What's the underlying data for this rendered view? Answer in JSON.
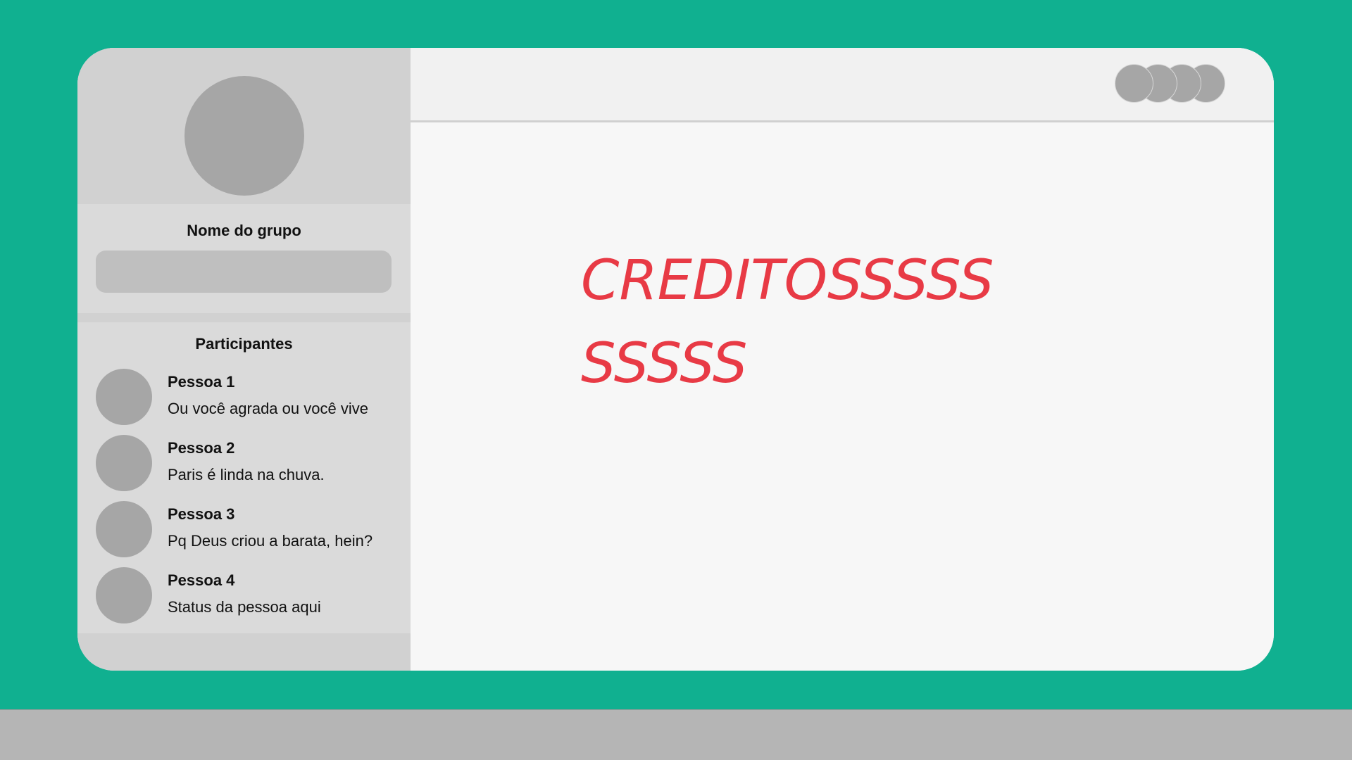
{
  "sidebar": {
    "group_name": "Nome do grupo",
    "group_input_value": "",
    "participants_title": "Participantes",
    "participants": [
      {
        "name": "Pessoa 1",
        "status": "Ou você agrada ou você vive"
      },
      {
        "name": "Pessoa 2",
        "status": "Paris é linda na chuva."
      },
      {
        "name": "Pessoa 3",
        "status": "Pq Deus criou a barata, hein?"
      },
      {
        "name": "Pessoa 4",
        "status": "Status da pessoa aqui"
      }
    ]
  },
  "main": {
    "content_lines": [
      "CREDITOSSSSS",
      "SSSSS"
    ]
  },
  "colors": {
    "background": "#10b090",
    "credits_text": "#e83a45",
    "avatar": "#a6a6a6",
    "sidebar": "#d1d1d1",
    "bottom_bar": "#b5b5b5"
  }
}
